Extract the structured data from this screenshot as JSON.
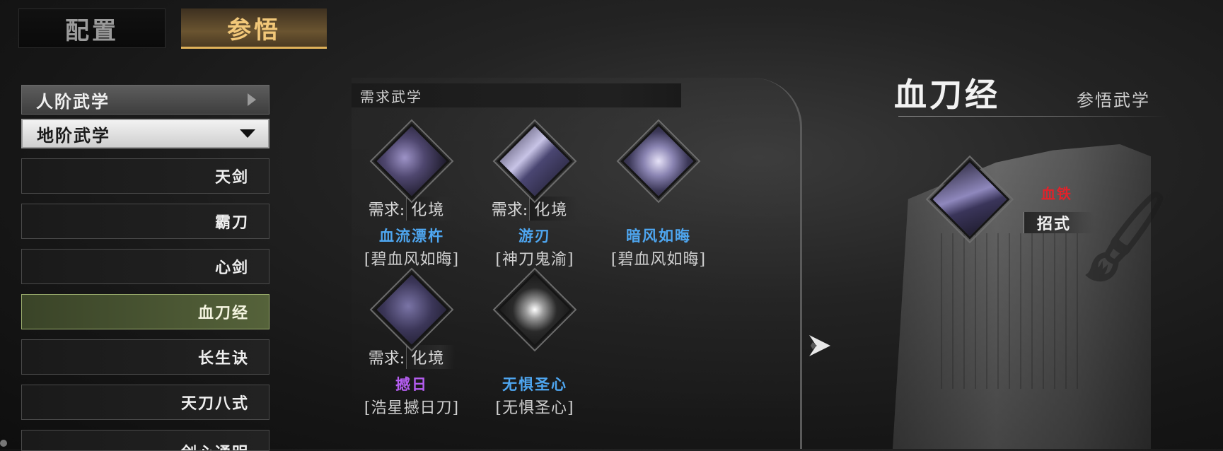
{
  "tabs": {
    "config_label": "配置",
    "enlighten_label": "参悟"
  },
  "sidebar": {
    "categories": [
      {
        "label": "人阶武学",
        "state": "collapsed"
      },
      {
        "label": "地阶武学",
        "state": "expanded"
      }
    ],
    "skills": [
      {
        "label": "天剑"
      },
      {
        "label": "霸刀"
      },
      {
        "label": "心剑"
      },
      {
        "label": "血刀经",
        "active": true
      },
      {
        "label": "长生诀"
      },
      {
        "label": "天刀八式"
      },
      {
        "label": "剑心通明"
      }
    ]
  },
  "requirements": {
    "header": "需求武学",
    "req_prefix": "需求:",
    "items": [
      {
        "icon": "purple-blade-slash-icon",
        "req_value": "化境",
        "name": "血流漂杵",
        "source": "[碧血风如晦]",
        "name_color": "#4ea6f0"
      },
      {
        "icon": "purple-wind-slash-icon",
        "req_value": "化境",
        "name": "游刃",
        "source": "[神刀鬼渝]",
        "name_color": "#4ea6f0"
      },
      {
        "icon": "purple-whirlwind-icon",
        "req_value": "",
        "name": "暗风如晦",
        "source": "[碧血风如晦]",
        "name_color": "#4ea6f0"
      },
      {
        "icon": "purple-swordsman-icon",
        "req_value": "化境",
        "name": "撼日",
        "source": "[浩星撼日刀]",
        "name_color": "#b45df0"
      },
      {
        "icon": "white-moon-figure-icon",
        "req_value": "",
        "name": "无惧圣心",
        "source": "[无惧圣心]",
        "name_color": "#4ea6f0"
      }
    ]
  },
  "detail": {
    "title": "血刀经",
    "subtitle": "参悟武学",
    "skill_icon": "purple-blade-slash-icon",
    "skill_name": "血铁",
    "skill_type": "招式",
    "skill_name_color": "#e0232b"
  }
}
